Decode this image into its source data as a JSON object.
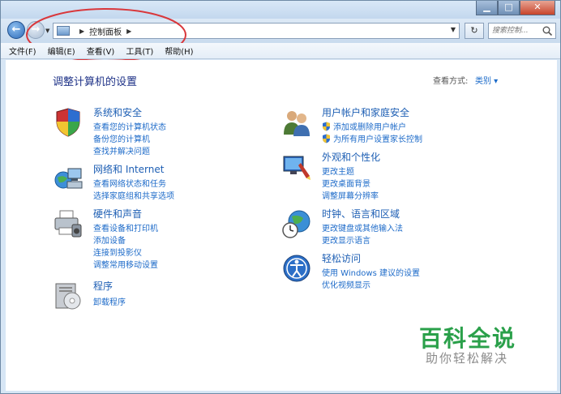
{
  "window": {
    "buttons": {
      "minimize": "▁",
      "maximize": "□",
      "close": "✕"
    }
  },
  "nav": {
    "back_glyph": "←",
    "forward_glyph": "→",
    "address": {
      "path": "控制面板"
    },
    "refresh_glyph": "↻",
    "search_placeholder": "搜索控制...",
    "annotation_color": "#d9373b"
  },
  "menubar": {
    "items": [
      "文件(F)",
      "编辑(E)",
      "查看(V)",
      "工具(T)",
      "帮助(H)"
    ]
  },
  "main": {
    "title": "调整计算机的设置",
    "view_by_label": "查看方式:",
    "view_by_value": "类别 ▾",
    "categories": [
      {
        "title": "系统和安全",
        "icon": "shield-icon",
        "links": [
          "查看您的计算机状态",
          "备份您的计算机",
          "查找并解决问题"
        ]
      },
      {
        "title": "网络和 Internet",
        "icon": "network-icon",
        "links": [
          "查看网络状态和任务",
          "选择家庭组和共享选项"
        ]
      },
      {
        "title": "硬件和声音",
        "icon": "printer-icon",
        "links": [
          "查看设备和打印机",
          "添加设备",
          "连接到投影仪",
          "调整常用移动设置"
        ]
      },
      {
        "title": "程序",
        "icon": "programs-icon",
        "links": [
          "卸载程序"
        ]
      },
      {
        "title": "用户帐户和家庭安全",
        "icon": "users-icon",
        "links": [
          "添加或删除用户帐户",
          "为所有用户设置家长控制"
        ]
      },
      {
        "title": "外观和个性化",
        "icon": "appearance-icon",
        "links": [
          "更改主题",
          "更改桌面背景",
          "调整屏幕分辨率"
        ]
      },
      {
        "title": "时钟、语言和区域",
        "icon": "clock-globe-icon",
        "links": [
          "更改键盘或其他输入法",
          "更改显示语言"
        ]
      },
      {
        "title": "轻松访问",
        "icon": "ease-of-access-icon",
        "links": [
          "使用 Windows 建议的设置",
          "优化视频显示"
        ]
      }
    ]
  },
  "watermark": {
    "title": "百科全说",
    "subtitle": "助你轻松解决"
  },
  "colors": {
    "link": "#1e6bc9",
    "title": "#1e3287",
    "watermark": "#2aa04a"
  }
}
